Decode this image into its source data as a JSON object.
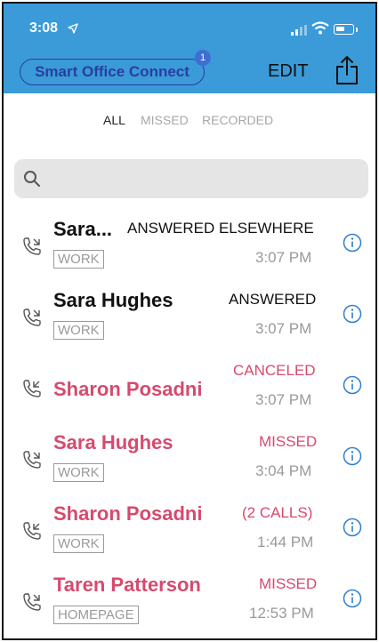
{
  "status_bar": {
    "time": "3:08"
  },
  "header": {
    "app_name": "Smart Office Connect",
    "badge": "1",
    "edit": "EDIT"
  },
  "filters": {
    "all": "ALL",
    "missed": "MISSED",
    "recorded": "RECORDED"
  },
  "search": {
    "placeholder": ""
  },
  "calls": [
    {
      "name": "Sara...",
      "status": "ANSWERED ELSEWHERE",
      "tag": "WORK",
      "time": "3:07 PM",
      "missed": false,
      "icon": "outgoing-call-icon"
    },
    {
      "name": "Sara Hughes",
      "status": "ANSWERED",
      "tag": "WORK",
      "time": "3:07 PM",
      "missed": false,
      "icon": "outgoing-call-icon"
    },
    {
      "name": "Sharon Posadni",
      "status": "CANCELED",
      "tag": "",
      "time": "3:07 PM",
      "missed": true,
      "icon": "incoming-call-icon"
    },
    {
      "name": "Sara Hughes",
      "status": "MISSED",
      "tag": "WORK",
      "time": "3:04 PM",
      "missed": true,
      "icon": "outgoing-call-icon"
    },
    {
      "name": "Sharon Posadni",
      "status": "(2 CALLS)",
      "tag": "WORK",
      "time": "1:44 PM",
      "missed": true,
      "icon": "incoming-call-icon"
    },
    {
      "name": "Taren Patterson",
      "status": "MISSED",
      "tag": "HOMEPAGE",
      "time": "12:53 PM",
      "missed": true,
      "icon": "outgoing-call-icon"
    }
  ],
  "colors": {
    "header": "#3a9bd8",
    "missed": "#d64a6e",
    "pill": "#2a3ea0",
    "info": "#2f7fd0"
  }
}
